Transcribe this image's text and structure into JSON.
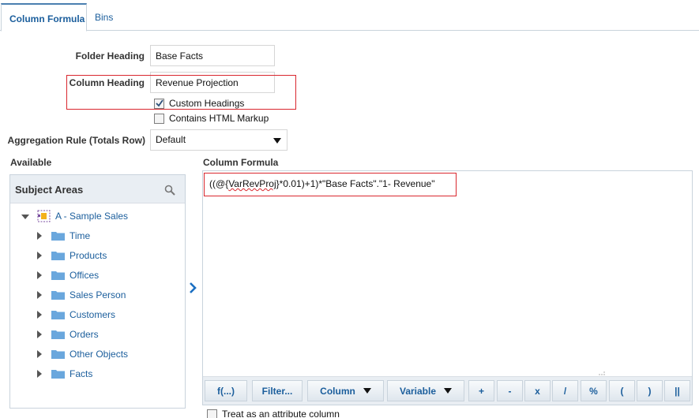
{
  "tabs": [
    {
      "label": "Column Formula",
      "active": true
    },
    {
      "label": "Bins",
      "active": false
    }
  ],
  "form": {
    "folder_heading_label": "Folder Heading",
    "folder_heading_value": "Base Facts",
    "column_heading_label": "Column Heading",
    "column_heading_value": "Revenue Projection",
    "custom_headings_label": "Custom Headings",
    "custom_headings_checked": true,
    "html_markup_label": "Contains HTML Markup",
    "html_markup_checked": false,
    "aggregation_label": "Aggregation Rule (Totals Row)",
    "aggregation_value": "Default"
  },
  "available": {
    "section_label": "Available",
    "panel_title": "Subject Areas",
    "root": "A - Sample Sales",
    "items": [
      "Time",
      "Products",
      "Offices",
      "Sales Person",
      "Customers",
      "Orders",
      "Other Objects",
      "Facts"
    ]
  },
  "formula": {
    "section_label": "Column Formula",
    "prefix": "((@{",
    "variable": "VarRevProj",
    "suffix": "}*0.01)+1)*\"Base Facts\".\"1- Revenue\""
  },
  "toolbar": {
    "fx": "f(...)",
    "filter": "Filter...",
    "column": "Column",
    "variable": "Variable",
    "plus": "+",
    "minus": "-",
    "times": "x",
    "divide": "/",
    "percent": "%",
    "lparen": "(",
    "rparen": ")",
    "concat": "||"
  },
  "attribute_column": {
    "label": "Treat as an attribute column",
    "checked": false
  },
  "colors": {
    "accent_blue": "#1b5e9c",
    "highlight_red": "#d9272e",
    "folder_blue": "#6aa7dd"
  }
}
